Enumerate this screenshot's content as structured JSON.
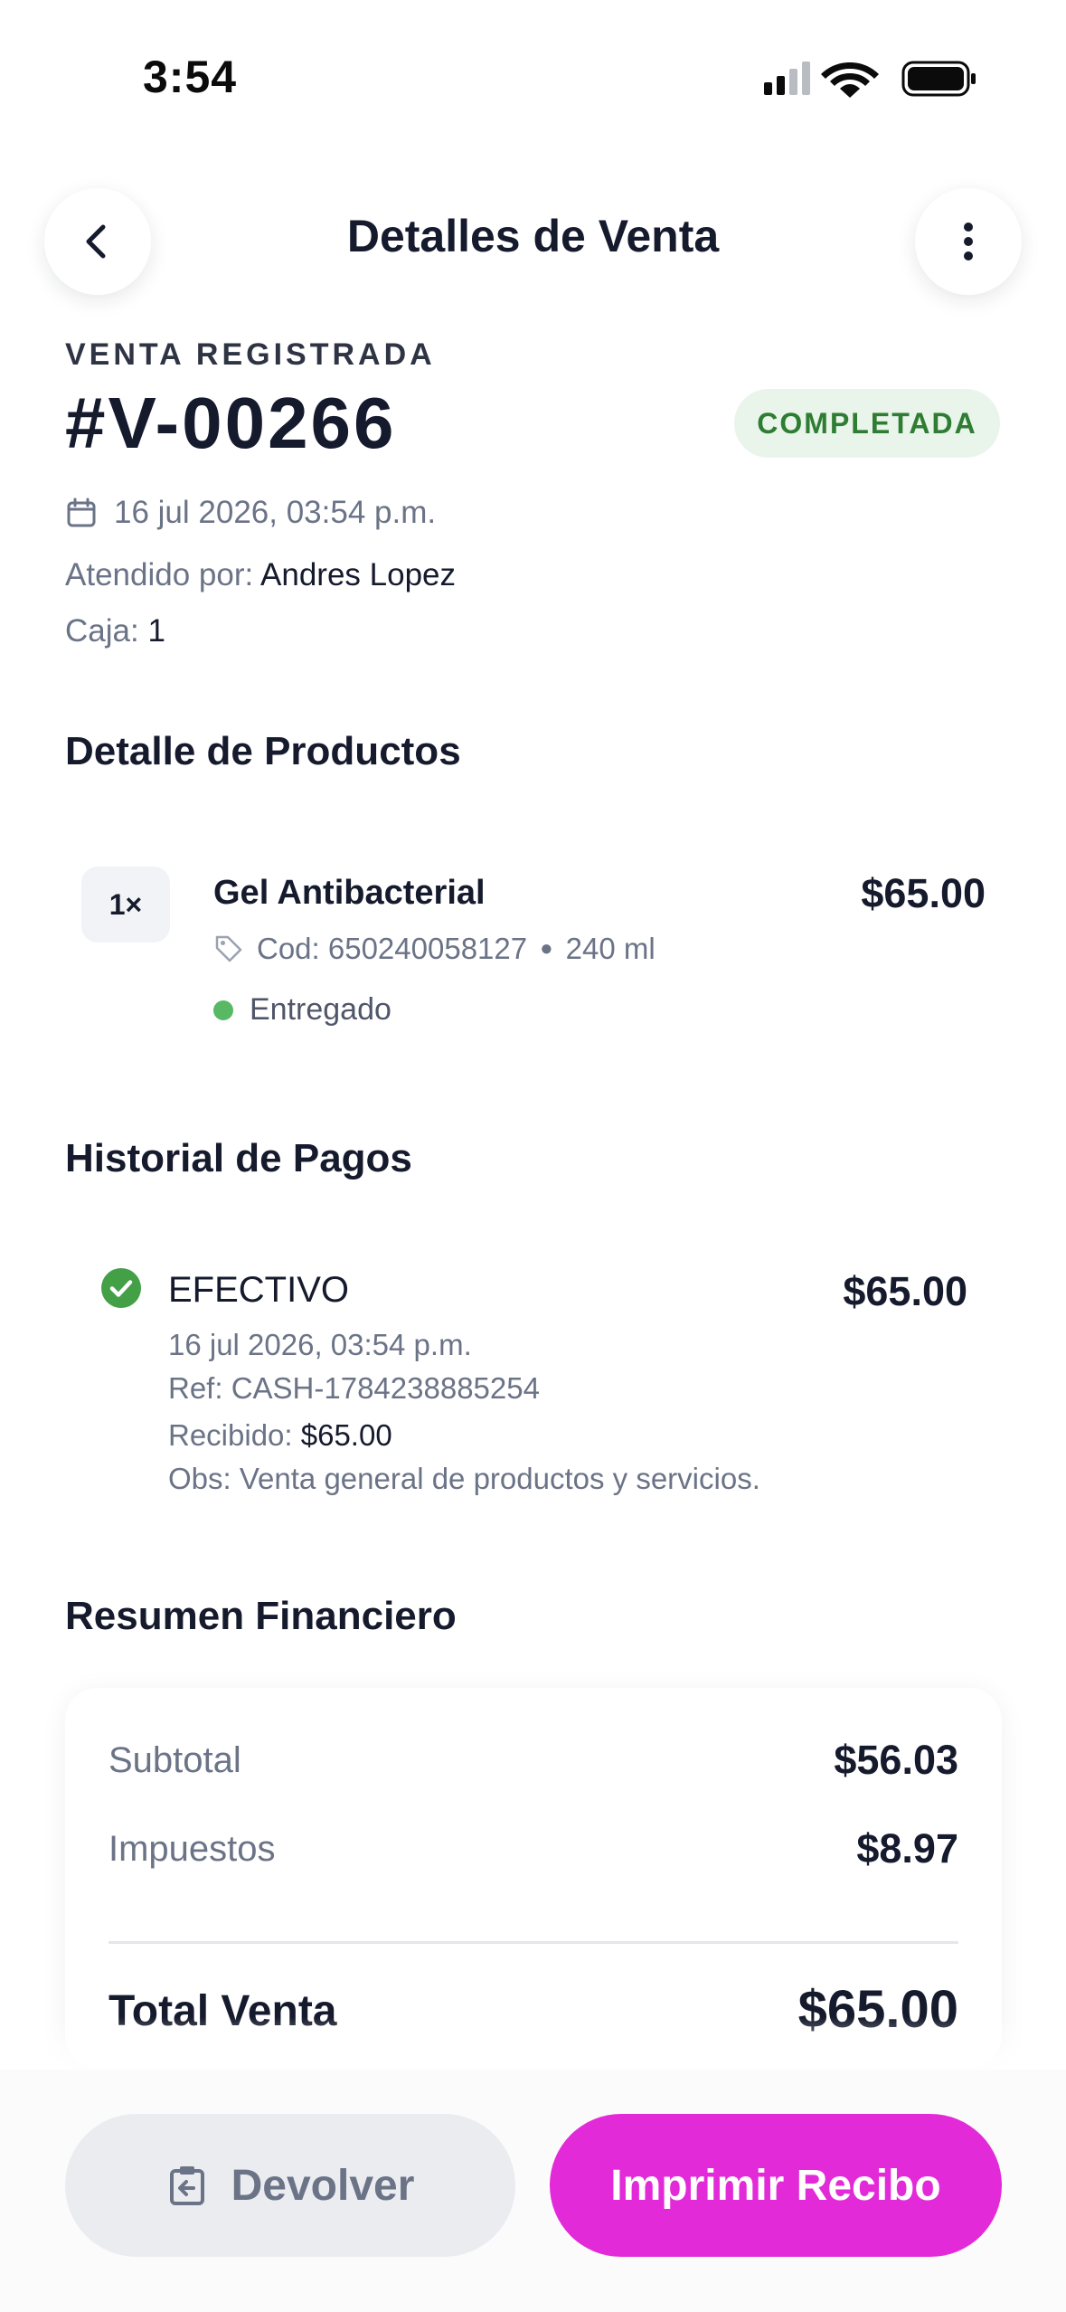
{
  "status_bar": {
    "time": "3:54"
  },
  "header": {
    "title": "Detalles de Venta"
  },
  "sale": {
    "overline": "VENTA REGISTRADA",
    "id": "#V-00266",
    "status": "COMPLETADA",
    "datetime": "16 jul 2026, 03:54 p.m.",
    "attended_label": "Atendido por:",
    "attended_by": "Andres Lopez",
    "box_label": "Caja:",
    "box": "1"
  },
  "products": {
    "title": "Detalle de Productos",
    "items": [
      {
        "qty": "1×",
        "name": "Gel Antibacterial",
        "price": "$65.00",
        "code": "Cod: 650240058127",
        "size": "240 ml",
        "status": "Entregado"
      }
    ]
  },
  "payments": {
    "title": "Historial de Pagos",
    "items": [
      {
        "method": "EFECTIVO",
        "amount": "$65.00",
        "datetime": "16 jul 2026, 03:54 p.m.",
        "ref": "Ref: CASH-1784238885254",
        "received_label": "Recibido:",
        "received": "$65.00",
        "obs": "Obs: Venta general de productos y servicios."
      }
    ]
  },
  "summary": {
    "title": "Resumen Financiero",
    "subtotal_label": "Subtotal",
    "subtotal": "$56.03",
    "tax_label": "Impuestos",
    "tax": "$8.97",
    "total_label": "Total Venta",
    "total": "$65.00"
  },
  "actions": {
    "return_label": "Devolver",
    "print_label": "Imprimir Recibo"
  },
  "colors": {
    "accent": "#e32ad8",
    "success": "#2e7d32",
    "success_bg": "#e9f4eb",
    "check_green": "#43a047",
    "text_primary": "#151a2d",
    "text_secondary": "#6b7387"
  },
  "icons": [
    "signal-icon",
    "wifi-icon",
    "battery-icon",
    "back-arrow-icon",
    "more-vertical-icon",
    "calendar-icon",
    "tag-icon",
    "check-circle-icon",
    "return-icon"
  ]
}
